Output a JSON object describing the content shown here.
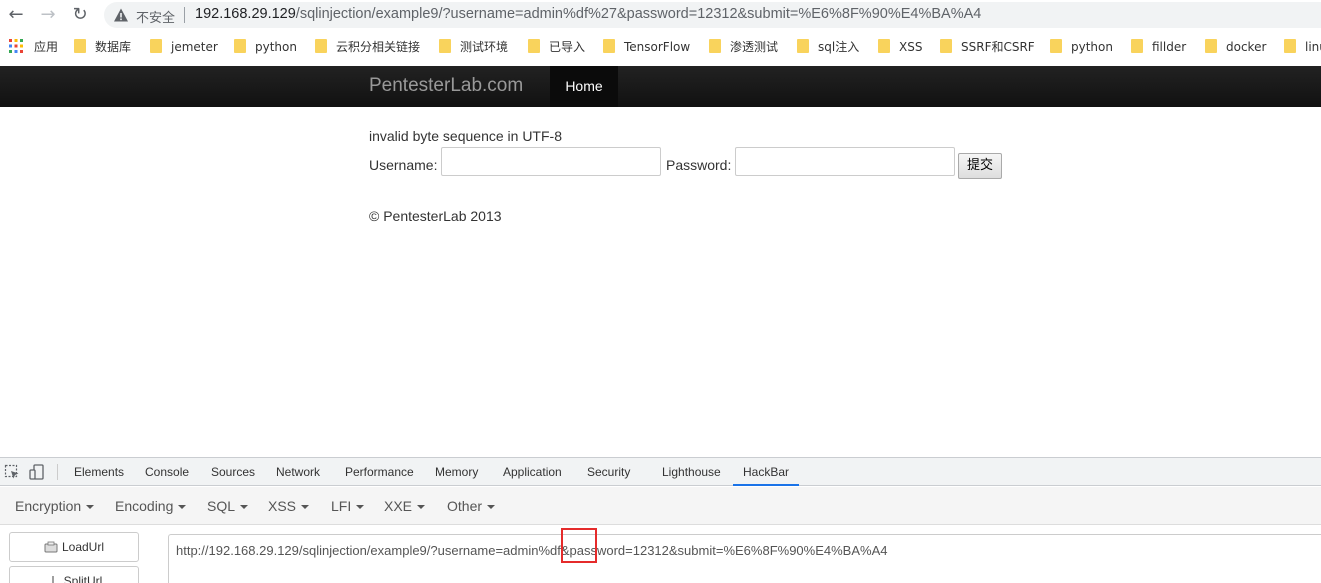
{
  "browser": {
    "not_secure_label": "不安全",
    "url_host": "192.168.29.129",
    "url_path": "/sqlinjection/example9/?username=admin%df%27&password=12312&submit=%E6%8F%90%E4%BA%A4"
  },
  "bookmarks": [
    {
      "label": "应用",
      "icon": "apps-grid-icon"
    },
    {
      "label": "数据库"
    },
    {
      "label": "jemeter"
    },
    {
      "label": "python"
    },
    {
      "label": "云积分相关链接"
    },
    {
      "label": "测试环境"
    },
    {
      "label": "已导入"
    },
    {
      "label": "TensorFlow"
    },
    {
      "label": "渗透测试"
    },
    {
      "label": "sql注入"
    },
    {
      "label": "XSS"
    },
    {
      "label": "SSRF和CSRF"
    },
    {
      "label": "python"
    },
    {
      "label": "fillder"
    },
    {
      "label": "docker"
    },
    {
      "label": "linu"
    }
  ],
  "site": {
    "brand": "PentesterLab.com",
    "nav_home": "Home",
    "error_message": "invalid byte sequence in UTF-8",
    "username_label": "Username:",
    "password_label": "Password:",
    "submit_label": "提交",
    "copyright": "© PentesterLab 2013"
  },
  "devtools": {
    "tabs": [
      "Elements",
      "Console",
      "Sources",
      "Network",
      "Performance",
      "Memory",
      "Application",
      "Security",
      "Lighthouse",
      "HackBar"
    ],
    "active_tab": "HackBar"
  },
  "hackbar": {
    "menus": [
      "Encryption",
      "Encoding",
      "SQL",
      "XSS",
      "LFI",
      "XXE",
      "Other"
    ],
    "load_url_label": "LoadUrl",
    "split_url_label": "SplitUrl",
    "url_value": "http://192.168.29.129/sqlinjection/example9/?username=admin%df&password=12312&submit=%E6%8F%90%E4%BA%A4",
    "highlight_color": "#e52b2b"
  }
}
